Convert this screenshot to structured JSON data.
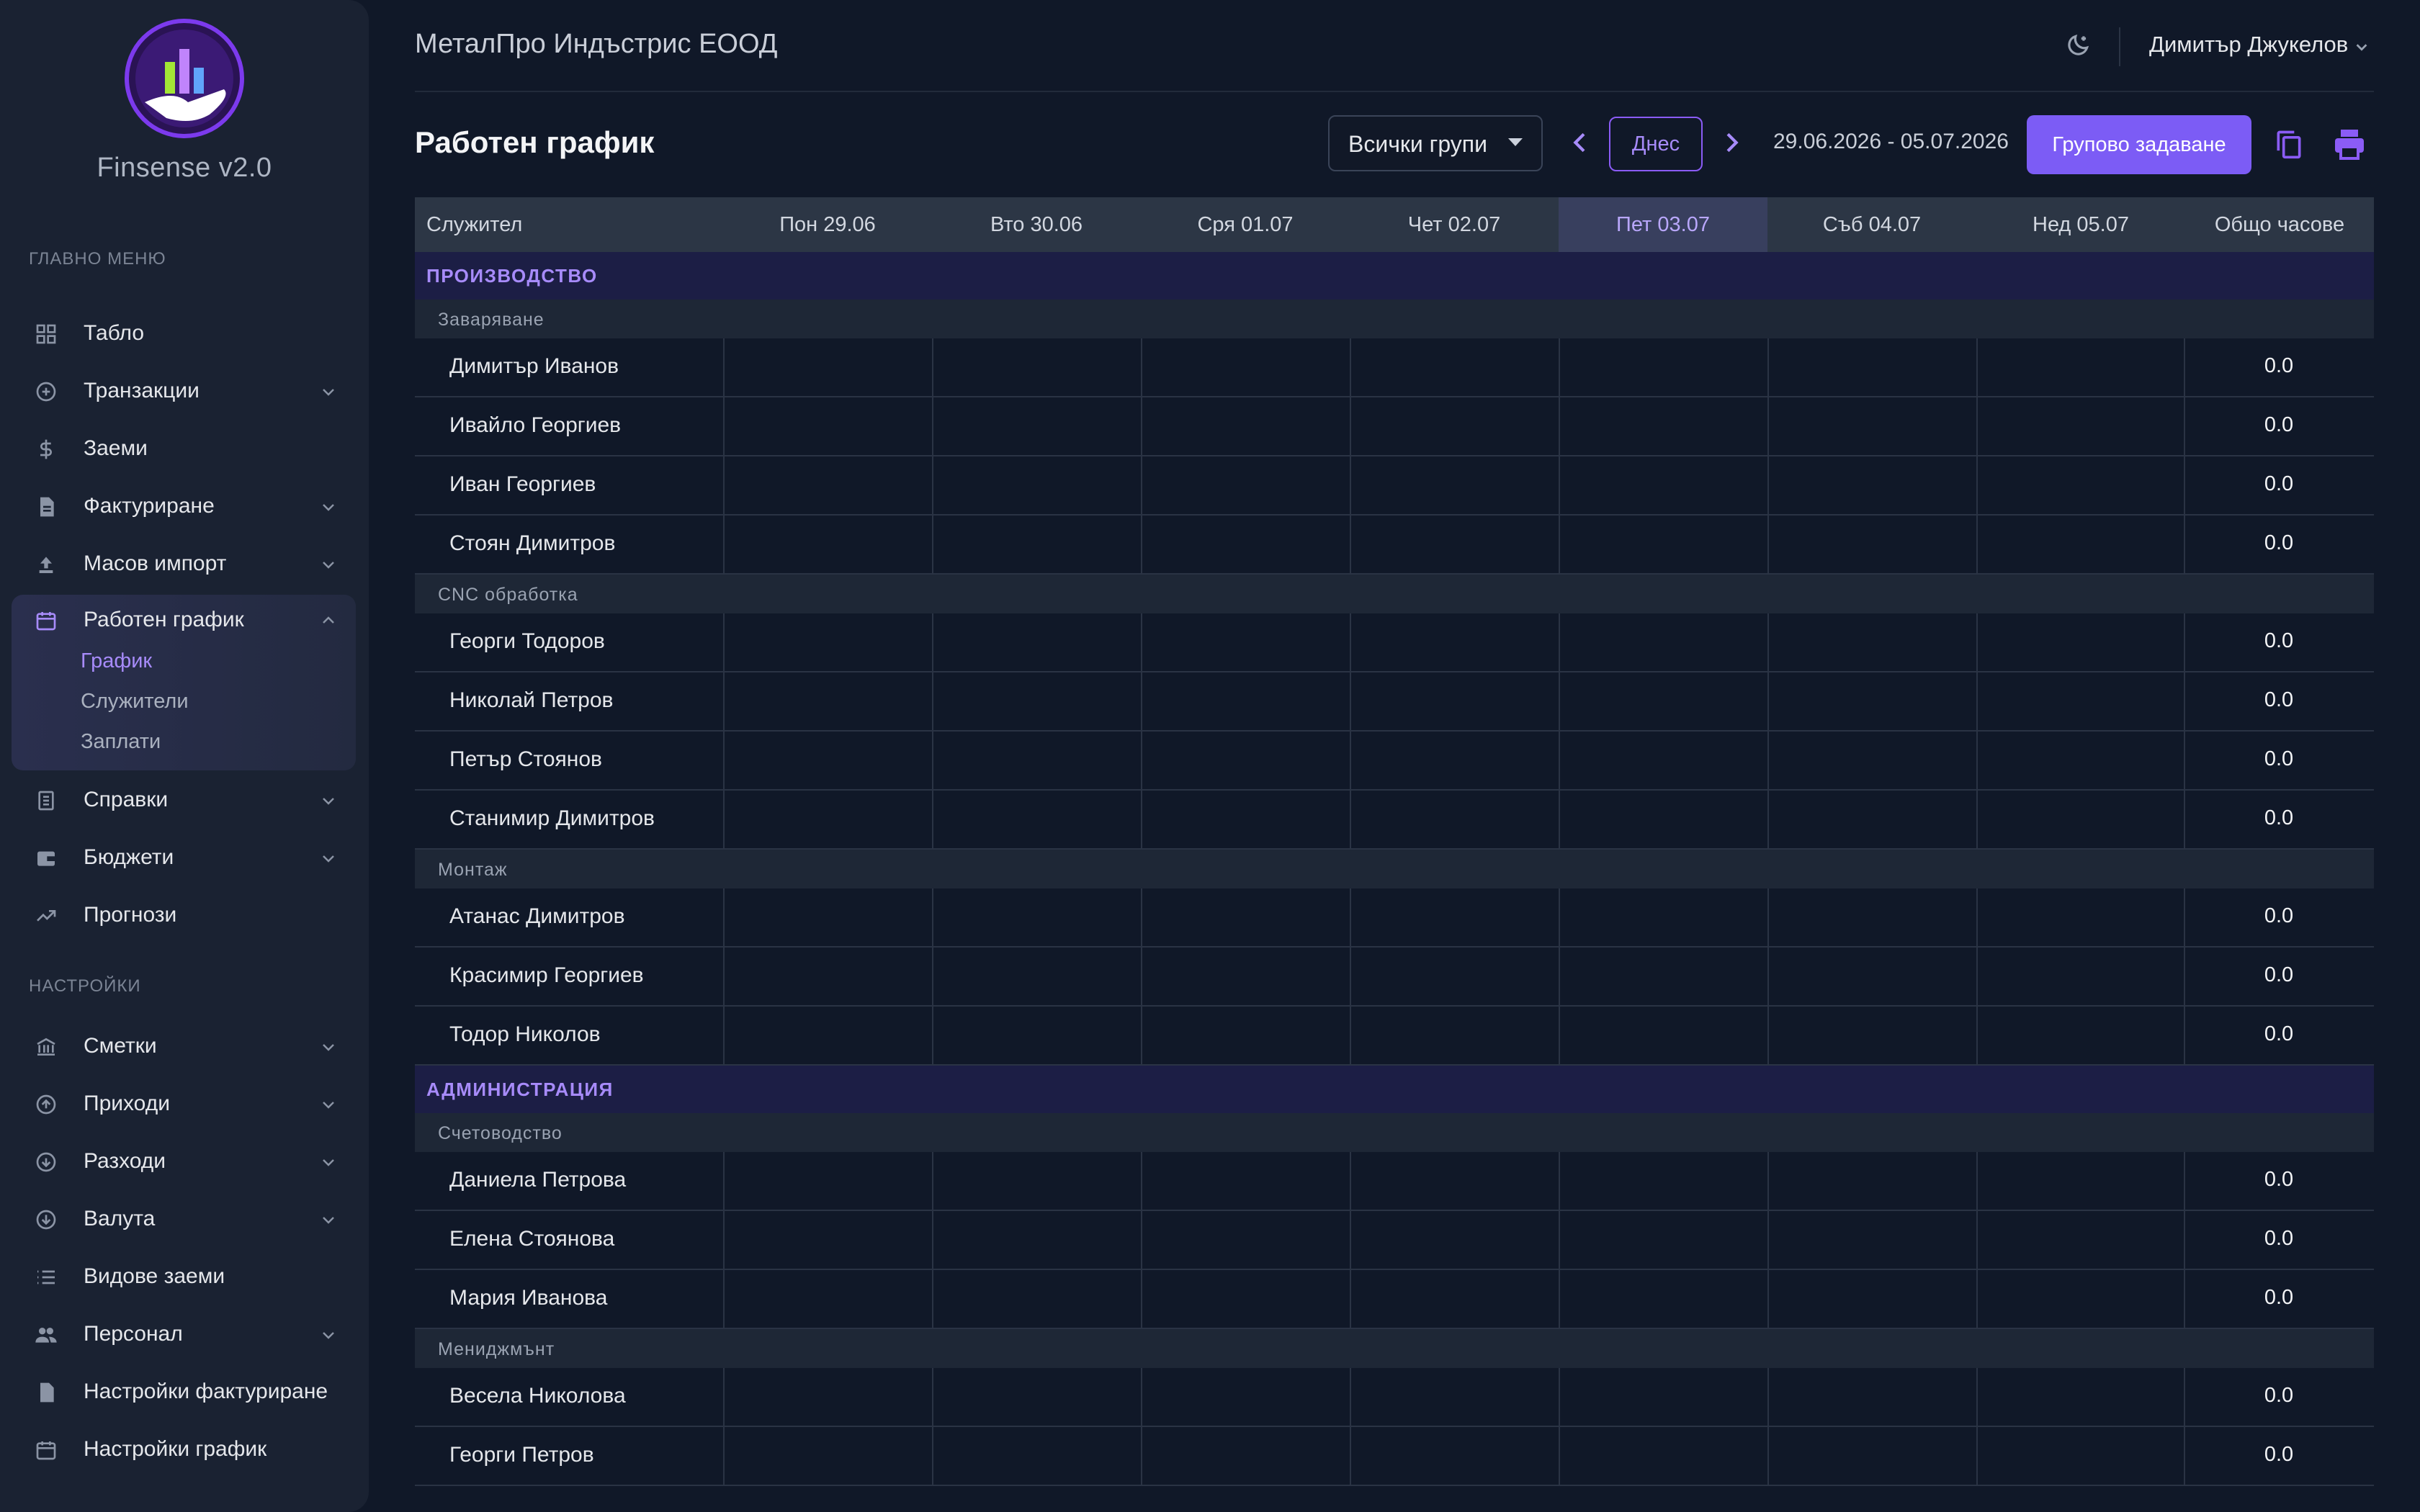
{
  "brand": {
    "name": "Finsense v2.0"
  },
  "sidebar": {
    "main_section": "ГЛАВНО МЕНЮ",
    "settings_section": "НАСТРОЙКИ",
    "items": [
      {
        "label": "Табло"
      },
      {
        "label": "Транзакции"
      },
      {
        "label": "Заеми"
      },
      {
        "label": "Фактуриране"
      },
      {
        "label": "Масов импорт"
      },
      {
        "label": "Работен график",
        "subitems": [
          "График",
          "Служители",
          "Заплати"
        ]
      },
      {
        "label": "Справки"
      },
      {
        "label": "Бюджети"
      },
      {
        "label": "Прогнози"
      }
    ],
    "settings_items": [
      {
        "label": "Сметки"
      },
      {
        "label": "Приходи"
      },
      {
        "label": "Разходи"
      },
      {
        "label": "Валута"
      },
      {
        "label": "Видове заеми"
      },
      {
        "label": "Персонал"
      },
      {
        "label": "Настройки фактуриране"
      },
      {
        "label": "Настройки график"
      }
    ]
  },
  "header": {
    "company": "МеталПро Индъстрис ЕООД",
    "user": "Димитър Джукелов"
  },
  "toolbar": {
    "title": "Работен график",
    "group_select": "Всички групи",
    "today": "Днес",
    "range": "29.06.2026 - 05.07.2026",
    "bulk": "Групово задаване"
  },
  "table": {
    "columns": [
      "Служител",
      "Пон 29.06",
      "Вто 30.06",
      "Сря 01.07",
      "Чет 02.07",
      "Пет 03.07",
      "Съб 04.07",
      "Нед 05.07",
      "Общо часове"
    ],
    "today_index": 5,
    "departments": [
      {
        "name": "ПРОИЗВОДСТВО",
        "groups": [
          {
            "name": "Заваряване",
            "employees": [
              {
                "name": "Димитър Иванов",
                "total": "0.0"
              },
              {
                "name": "Ивайло Георгиев",
                "total": "0.0"
              },
              {
                "name": "Иван Георгиев",
                "total": "0.0"
              },
              {
                "name": "Стоян Димитров",
                "total": "0.0"
              }
            ]
          },
          {
            "name": "CNC обработка",
            "employees": [
              {
                "name": "Георги Тодоров",
                "total": "0.0"
              },
              {
                "name": "Николай Петров",
                "total": "0.0"
              },
              {
                "name": "Петър Стоянов",
                "total": "0.0"
              },
              {
                "name": "Станимир Димитров",
                "total": "0.0"
              }
            ]
          },
          {
            "name": "Монтаж",
            "employees": [
              {
                "name": "Атанас Димитров",
                "total": "0.0"
              },
              {
                "name": "Красимир Георгиев",
                "total": "0.0"
              },
              {
                "name": "Тодор Николов",
                "total": "0.0"
              }
            ]
          }
        ]
      },
      {
        "name": "АДМИНИСТРАЦИЯ",
        "groups": [
          {
            "name": "Счетоводство",
            "employees": [
              {
                "name": "Даниела Петрова",
                "total": "0.0"
              },
              {
                "name": "Елена Стоянова",
                "total": "0.0"
              },
              {
                "name": "Мария Иванова",
                "total": "0.0"
              }
            ]
          },
          {
            "name": "Мениджмънт",
            "employees": [
              {
                "name": "Весела Николова",
                "total": "0.0"
              },
              {
                "name": "Георги Петров",
                "total": "0.0"
              }
            ]
          }
        ]
      }
    ]
  },
  "colors": {
    "accent": "#8b5cf6",
    "background": "#101828",
    "sidebar": "#1a2232"
  }
}
